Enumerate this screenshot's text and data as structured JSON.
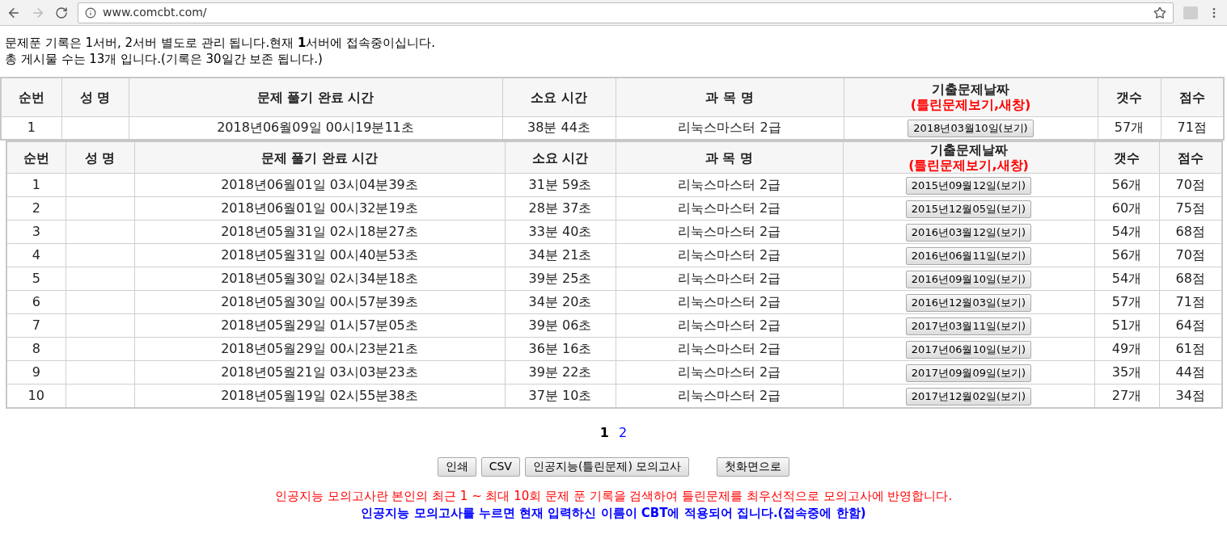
{
  "browser": {
    "url": "www.comcbt.com/"
  },
  "intro": [
    "문제푼 기록은 1서버, 2서버 별도로 관리 됩니다.현재 **1**서버에 접속중이십니다.",
    "총 게시물 수는 13개 입니다.(기록은 30일간 보존 됩니다.)"
  ],
  "tables": [
    {
      "columns": [
        "순번",
        "성 명",
        "문제 풀기 완료 시간",
        "소요 시간",
        "과 목 명",
        "기출문제날짜",
        "갯수",
        "점수"
      ],
      "column_note": "(틀린문제보기,새창)",
      "rows": [
        {
          "no": "1",
          "completed": "2018년06월09일 00시19분11초",
          "duration": "38분 44초",
          "subject": "리눅스마스터 2급",
          "exam_button": "2018년03월10일(보기)",
          "count": "57개",
          "score": "71점"
        }
      ]
    },
    {
      "columns": [
        "순번",
        "성 명",
        "문제 풀기 완료 시간",
        "소요 시간",
        "과 목 명",
        "기출문제날짜",
        "갯수",
        "점수"
      ],
      "column_note": "(틀린문제보기,새창)",
      "rows": [
        {
          "no": "1",
          "completed": "2018년06월01일 03시04분39초",
          "duration": "31분 59초",
          "subject": "리눅스마스터 2급",
          "exam_button": "2015년09월12일(보기)",
          "count": "56개",
          "score": "70점"
        },
        {
          "no": "2",
          "completed": "2018년06월01일 00시32분19초",
          "duration": "28분 37초",
          "subject": "리눅스마스터 2급",
          "exam_button": "2015년12월05일(보기)",
          "count": "60개",
          "score": "75점"
        },
        {
          "no": "3",
          "completed": "2018년05월31일 02시18분27초",
          "duration": "33분 40초",
          "subject": "리눅스마스터 2급",
          "exam_button": "2016년03월12일(보기)",
          "count": "54개",
          "score": "68점"
        },
        {
          "no": "4",
          "completed": "2018년05월31일 00시40분53초",
          "duration": "34분 21초",
          "subject": "리눅스마스터 2급",
          "exam_button": "2016년06월11일(보기)",
          "count": "56개",
          "score": "70점"
        },
        {
          "no": "5",
          "completed": "2018년05월30일 02시34분18초",
          "duration": "39분 25초",
          "subject": "리눅스마스터 2급",
          "exam_button": "2016년09월10일(보기)",
          "count": "54개",
          "score": "68점"
        },
        {
          "no": "6",
          "completed": "2018년05월30일 00시57분39초",
          "duration": "34분 20초",
          "subject": "리눅스마스터 2급",
          "exam_button": "2016년12월03일(보기)",
          "count": "57개",
          "score": "71점"
        },
        {
          "no": "7",
          "completed": "2018년05월29일 01시57분05초",
          "duration": "39분 06초",
          "subject": "리눅스마스터 2급",
          "exam_button": "2017년03월11일(보기)",
          "count": "51개",
          "score": "64점"
        },
        {
          "no": "8",
          "completed": "2018년05월29일 00시23분21초",
          "duration": "36분 16초",
          "subject": "리눅스마스터 2급",
          "exam_button": "2017년06월10일(보기)",
          "count": "49개",
          "score": "61점"
        },
        {
          "no": "9",
          "completed": "2018년05월21일 03시03분23초",
          "duration": "39분 22초",
          "subject": "리눅스마스터 2급",
          "exam_button": "2017년09월09일(보기)",
          "count": "35개",
          "score": "44점"
        },
        {
          "no": "10",
          "completed": "2018년05월19일 02시55분38초",
          "duration": "37분 10초",
          "subject": "리눅스마스터 2급",
          "exam_button": "2017년12월02일(보기)",
          "count": "27개",
          "score": "34점"
        }
      ]
    }
  ],
  "pagination": [
    {
      "label": "1",
      "selected": true
    },
    {
      "label": "2",
      "selected": false
    }
  ],
  "buttons": [
    "인쇄",
    "CSV",
    "인공지능(틀린문제) 모의고사",
    "첫화면으로"
  ],
  "notices": [
    {
      "text": "인공지능 모의고사란 본인의 최근 1 ~ 최대 10회 문제 푼 기록을 검색하여 틀린문제를 최우선적으로 모의고사에 반영합니다.",
      "color": "#ff0000"
    },
    {
      "text": "인공지능 모의고사를 누르면 현재 입력하신 이름이 CBT에 적용되어 집니다.(접속중에 한함)",
      "color": "#0000ff"
    }
  ]
}
